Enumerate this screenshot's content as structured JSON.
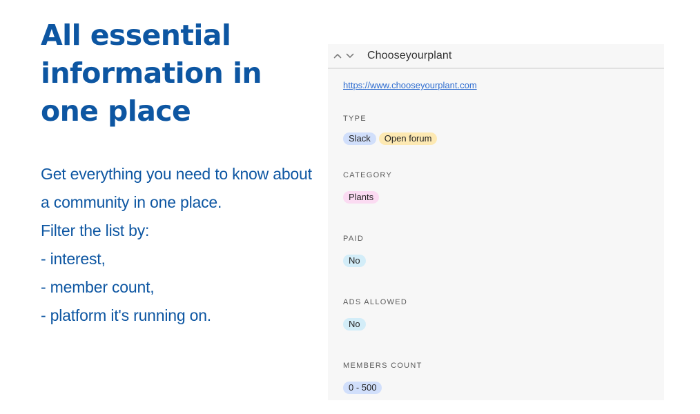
{
  "hero": {
    "title": "All essential information in one place",
    "lines": [
      "Get everything you need to know about",
      "a community in one place.",
      "Filter the list by:",
      "- interest,",
      "- member count,",
      "- platform it's running on."
    ]
  },
  "record": {
    "title": "Chooseyourplant",
    "url": "https://www.chooseyourplant.com",
    "fields": [
      {
        "label": "TYPE",
        "tags": [
          {
            "text": "Slack",
            "color": "#d1dffb"
          },
          {
            "text": "Open forum",
            "color": "#fde9b3"
          }
        ]
      },
      {
        "label": "CATEGORY",
        "tags": [
          {
            "text": "Plants",
            "color": "#fbdbf2"
          }
        ]
      },
      {
        "label": "PAID",
        "tags": [
          {
            "text": "No",
            "color": "#d3edf8"
          }
        ]
      },
      {
        "label": "ADS ALLOWED",
        "tags": [
          {
            "text": "No",
            "color": "#d3edf8"
          }
        ]
      },
      {
        "label": "MEMBERS COUNT",
        "tags": [
          {
            "text": "0 - 500",
            "color": "#d1dffb"
          }
        ]
      }
    ]
  },
  "icons": {
    "prev": "chevron-up-icon",
    "next": "chevron-down-icon"
  },
  "colors": {
    "accent": "#0d56a2",
    "link": "#2d6cd0",
    "card_bg": "#f7f7f7"
  }
}
